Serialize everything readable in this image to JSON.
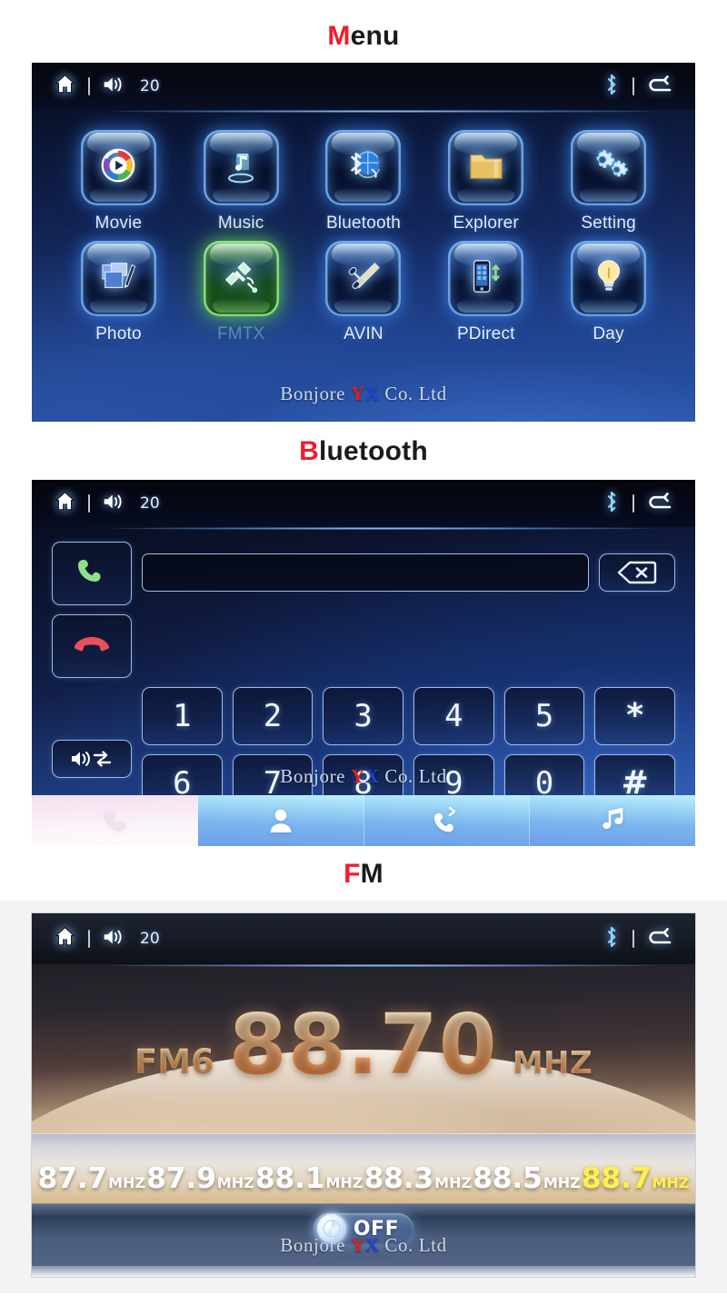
{
  "sections": [
    {
      "id": "menu",
      "accent": "M",
      "rest": "enu"
    },
    {
      "id": "bluetooth",
      "accent": "B",
      "rest": "luetooth"
    },
    {
      "id": "fm",
      "accent": "F",
      "rest": "M"
    }
  ],
  "accent_color": "#ef1d2e",
  "statusbar": {
    "home_icon": "home-icon",
    "separator": "|",
    "volume_icon": "volume-icon",
    "volume_value": "20",
    "bluetooth_icon": "bluetooth-icon",
    "back_icon": "back-arrow-icon"
  },
  "watermark": {
    "prefix": "Bonjore ",
    "y": "Y",
    "x": "X",
    "suffix": " Co. Ltd"
  },
  "menu_screen": {
    "apps": [
      {
        "label": "Movie",
        "icon": "movie-play-icon",
        "state": "normal"
      },
      {
        "label": "Music",
        "icon": "music-note-icon",
        "state": "normal"
      },
      {
        "label": "Bluetooth",
        "icon": "bluetooth-globe-icon",
        "state": "normal"
      },
      {
        "label": "Explorer",
        "icon": "folder-icon",
        "state": "normal"
      },
      {
        "label": "Setting",
        "icon": "gears-icon",
        "state": "normal"
      },
      {
        "label": "Photo",
        "icon": "photo-brush-icon",
        "state": "normal"
      },
      {
        "label": "FMTX",
        "icon": "satellite-icon",
        "state": "active"
      },
      {
        "label": "AVIN",
        "icon": "rca-plug-icon",
        "state": "normal"
      },
      {
        "label": "PDirect",
        "icon": "phone-sync-icon",
        "state": "normal"
      },
      {
        "label": "Day",
        "icon": "lightbulb-icon",
        "state": "normal"
      }
    ]
  },
  "bluetooth_screen": {
    "dial_input_value": "",
    "side_buttons": [
      {
        "name": "call-button",
        "icon": "green-handset-icon"
      },
      {
        "name": "hangup-button",
        "icon": "red-handset-icon"
      },
      {
        "name": "audio-transfer-button",
        "icon": "speaker-swap-icon"
      }
    ],
    "backspace": {
      "name": "backspace-button",
      "icon": "backspace-x-icon"
    },
    "keypad_row1": [
      "1",
      "2",
      "3",
      "4",
      "5",
      "*"
    ],
    "keypad_row2": [
      "6",
      "7",
      "8",
      "9",
      "0",
      "#"
    ],
    "tabs": [
      {
        "name": "tab-dialpad",
        "icon": "handset-icon",
        "active": true
      },
      {
        "name": "tab-contacts",
        "icon": "contact-person-icon",
        "active": false
      },
      {
        "name": "tab-calllog",
        "icon": "call-history-icon",
        "active": false
      },
      {
        "name": "tab-music",
        "icon": "music-notes-icon",
        "active": false
      }
    ]
  },
  "fm_screen": {
    "band": "FM6",
    "frequency": "88.70",
    "unit": "MHZ",
    "presets": [
      {
        "value": "87.7",
        "unit": "MHZ",
        "active": false
      },
      {
        "value": "87.9",
        "unit": "MHZ",
        "active": false
      },
      {
        "value": "88.1",
        "unit": "MHZ",
        "active": false
      },
      {
        "value": "88.3",
        "unit": "MHZ",
        "active": false
      },
      {
        "value": "88.5",
        "unit": "MHZ",
        "active": false
      },
      {
        "value": "88.7",
        "unit": "MHZ",
        "active": true
      }
    ],
    "power_toggle": {
      "label": "OFF",
      "icon": "power-knob-icon"
    },
    "active_preset_color": "#ffef52",
    "frequency_color": "#f1a363"
  }
}
